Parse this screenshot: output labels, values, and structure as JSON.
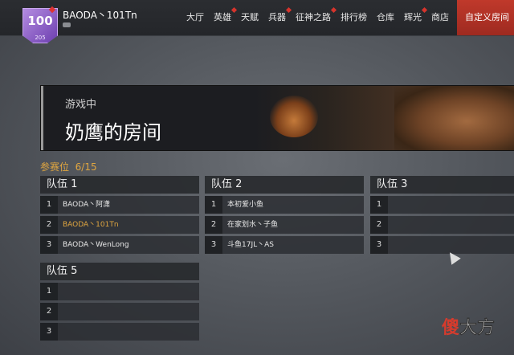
{
  "player": {
    "level": "100",
    "sub_level": "205",
    "name": "BAODA丶101Tn"
  },
  "nav": {
    "items": [
      "大厅",
      "英雄",
      "天赋",
      "兵器",
      "征神之路",
      "排行榜",
      "仓库",
      "辉光",
      "商店"
    ],
    "active": "自定义房间"
  },
  "room": {
    "status": "游戏中",
    "title": "奶鹰的房间",
    "slots_label": "参赛位",
    "slots_value": "6/15"
  },
  "teams": [
    {
      "name": "队伍 1",
      "members": [
        "BAODA丶阿潇",
        "BAODA丶101Tn",
        "BAODA丶WenLong"
      ]
    },
    {
      "name": "队伍 2",
      "members": [
        "本初爱小鱼",
        "在家划水丶子鱼",
        "斗鱼17JL丶AS"
      ]
    },
    {
      "name": "队伍 3",
      "members": [
        "",
        "",
        ""
      ]
    },
    {
      "name": "队伍 5",
      "members": [
        "",
        "",
        ""
      ]
    }
  ],
  "slot_numbers": [
    "1",
    "2",
    "3"
  ],
  "watermark": {
    "part1": "傻",
    "part2": "大方"
  },
  "colors": {
    "accent_red": "#c0392b",
    "highlight_gold": "#e0a640",
    "brand_purple": "#8a5cc7"
  }
}
